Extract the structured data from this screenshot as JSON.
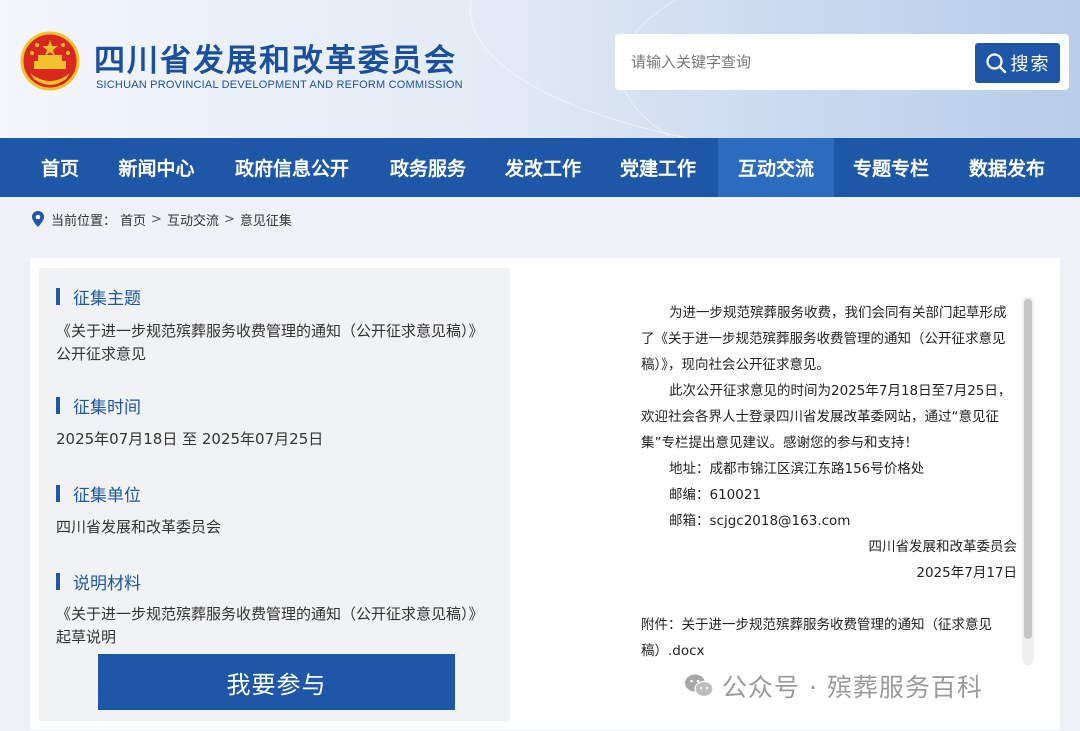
{
  "header": {
    "title": "四川省发展和改革委员会",
    "subtitle": "SICHUAN PROVINCIAL DEVELOPMENT AND REFORM COMMISSION",
    "emblem_icon": "national-emblem-icon"
  },
  "search": {
    "placeholder": "请输入关键字查询",
    "button_label": "搜索",
    "icon": "search-icon"
  },
  "nav": {
    "items": [
      {
        "label": "首页"
      },
      {
        "label": "新闻中心"
      },
      {
        "label": "政府信息公开"
      },
      {
        "label": "政务服务"
      },
      {
        "label": "发改工作"
      },
      {
        "label": "党建工作"
      },
      {
        "label": "互动交流",
        "active": true
      },
      {
        "label": "专题专栏"
      },
      {
        "label": "数据发布"
      }
    ]
  },
  "breadcrumb": {
    "prefix": "当前位置：",
    "items": [
      "首页",
      "互动交流",
      "意见征集"
    ],
    "separator": ">",
    "icon": "location-pin-icon"
  },
  "solicitation": {
    "topic_label": "征集主题",
    "topic": "《关于进一步规范殡葬服务收费管理的通知（公开征求意见稿）》公开征求意见",
    "time_label": "征集时间",
    "time": "2025年07月18日 至 2025年07月25日",
    "unit_label": "征集单位",
    "unit": "四川省发展和改革委员会",
    "material_label": "说明材料",
    "material": "《关于进一步规范殡葬服务收费管理的通知（公开征求意见稿）》起草说明",
    "join_button": "我要参与"
  },
  "notice": {
    "p1": "为进一步规范殡葬服务收费，我们会同有关部门起草形成了《关于进一步规范殡葬服务收费管理的通知（公开征求意见稿）》，现向社会公开征求意见。",
    "p2": "此次公开征求意见的时间为2025年7月18日至7月25日，欢迎社会各界人士登录四川省发展改革委网站，通过“意见征集”专栏提出意见建议。感谢您的参与和支持！",
    "address": "地址：成都市锦江区滨江东路156号价格处",
    "postcode": "邮编：610021",
    "email": "邮箱：scjgc2018@163.com",
    "signature": "四川省发展和改革委员会",
    "date": "2025年7月17日",
    "attachment": "附件：关于进一步规范殡葬服务收费管理的通知（征求意见稿）.docx"
  },
  "watermark": {
    "text": "公众号 · 殡葬服务百科",
    "icon": "wechat-icon"
  },
  "colors": {
    "brand_blue": "#1e57a8",
    "nav_active": "#2c6cc0",
    "panel_gray": "#f1f2f4"
  }
}
